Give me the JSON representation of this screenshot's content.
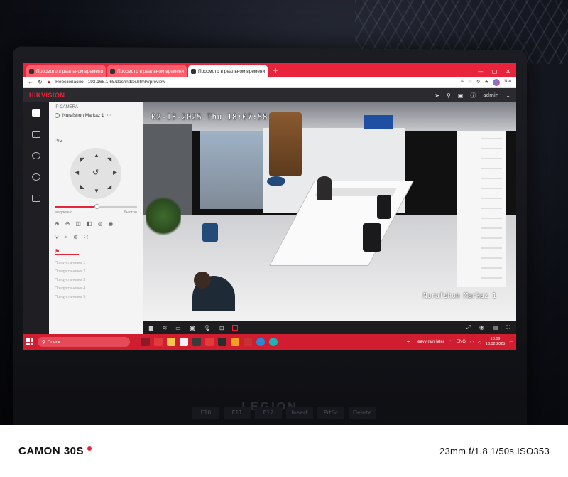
{
  "browser": {
    "tabs": [
      {
        "label": "Просмотр в реальном времени",
        "active": false
      },
      {
        "label": "Просмотр в реальном времени",
        "active": false
      },
      {
        "label": "Просмотр в реальном времени",
        "active": true
      }
    ],
    "new_tab": "+",
    "security_warning": "Небезопасно",
    "url": "192.168.1.65/doc/index.html#/preview",
    "profile_label": "Чат"
  },
  "hikvision": {
    "logo": "HIKVISION",
    "user": "admin"
  },
  "panel": {
    "section": "IP CAMERA",
    "camera_name": "Nurafshon Markaz 1",
    "ptz_label": "PTZ",
    "speed_min": "медленно",
    "speed_max": "быстро",
    "presets": [
      "Предустановка 1",
      "Предустановка 2",
      "Предустановка 3",
      "Предустановка 4",
      "Предустановка 5"
    ]
  },
  "video": {
    "osd_timestamp": "02-13-2025 Thu 18:07:58",
    "osd_camera_name": "Nurafshon Markaz 1"
  },
  "taskbar": {
    "search_placeholder": "Поиск",
    "weather": "Heavy rain later",
    "language": "ENG",
    "time": "18:09",
    "date": "13.02.2025"
  },
  "laptop": {
    "brand": "LEGION",
    "keys": [
      "F10",
      "F11",
      "F12",
      "Insert",
      "PrtSc",
      "Delete"
    ]
  },
  "watermark": {
    "device": "CAMON 30S",
    "exif": "23mm  f/1.8  1/50s  ISO353"
  },
  "colors": {
    "accent": "#e8233b",
    "taskbar": "#d01d2f"
  }
}
